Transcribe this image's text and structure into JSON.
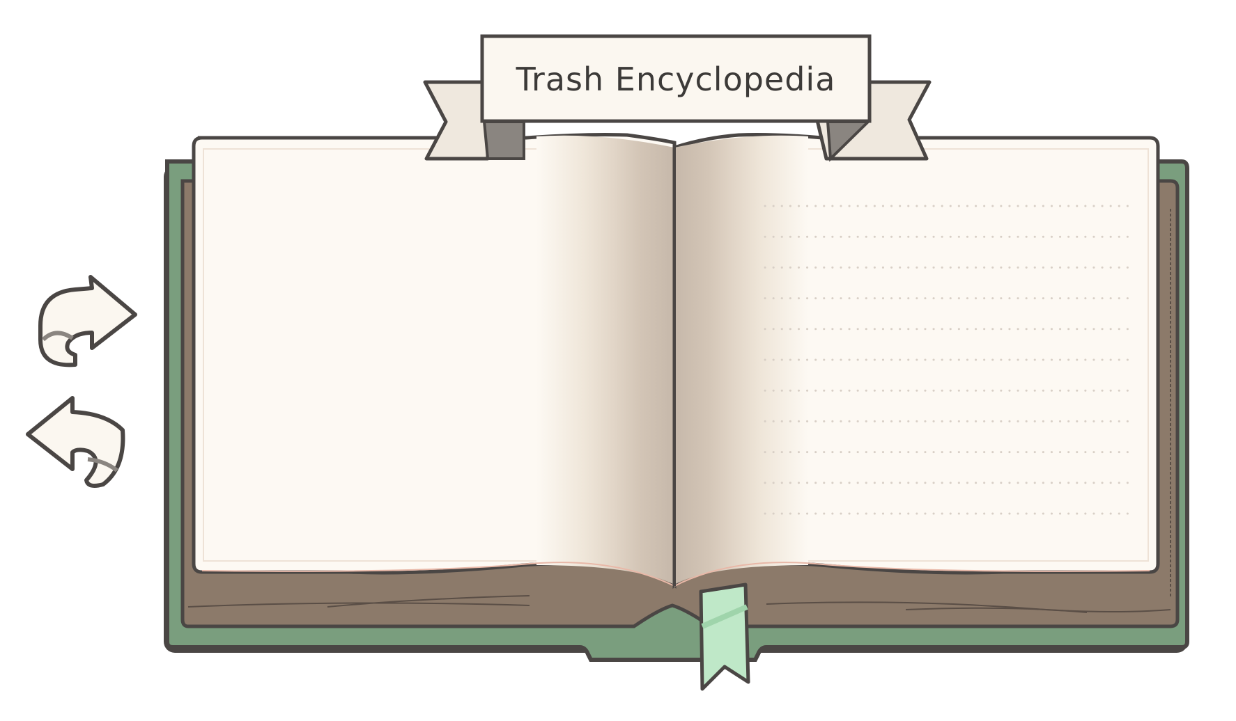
{
  "title_banner": {
    "text": "Trash Encyclopedia"
  },
  "navigation": {
    "next_icon": "curled-arrow-right-icon",
    "prev_icon": "curled-arrow-left-icon"
  },
  "book": {
    "left_page": {
      "lines": []
    },
    "right_page": {
      "dotted_lines": 11
    }
  },
  "colors": {
    "cover_green": "#7a9e7e",
    "page_cream": "#fdf9f3",
    "page_edge_brown": "#8c7a6a",
    "bookmark_green": "#bfe8c8",
    "outline": "#4a4644"
  }
}
